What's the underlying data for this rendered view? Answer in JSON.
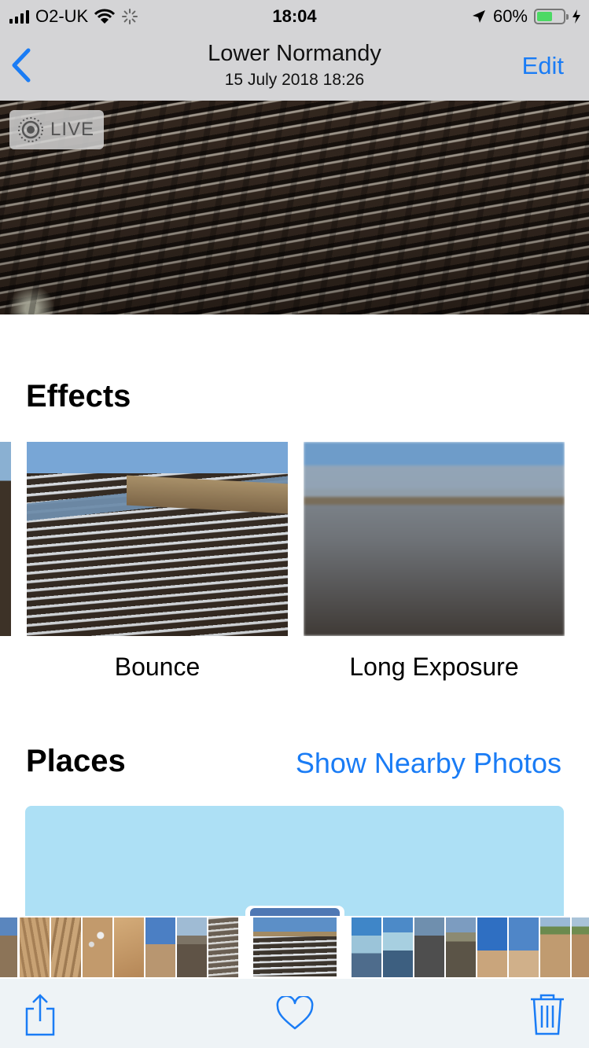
{
  "status_bar": {
    "carrier": "O2-UK",
    "time": "18:04",
    "battery": "60%",
    "battery_level": 0.6
  },
  "nav": {
    "title": "Lower Normandy",
    "subtitle": "15 July 2018  18:26",
    "edit_label": "Edit"
  },
  "photo": {
    "live_label": "LIVE"
  },
  "effects": {
    "title": "Effects",
    "items": [
      {
        "label": "Bounce"
      },
      {
        "label": "Long Exposure"
      }
    ]
  },
  "places": {
    "title": "Places",
    "nearby_link": "Show Nearby Photos",
    "map_color": "#ade0f5"
  },
  "colors": {
    "accent": "#1a7cf5",
    "battery_green": "#4cd964"
  },
  "icons": {
    "back": "chevron-left-icon",
    "share": "share-icon",
    "favorite": "heart-icon",
    "delete": "trash-icon",
    "live": "live-photo-icon"
  }
}
